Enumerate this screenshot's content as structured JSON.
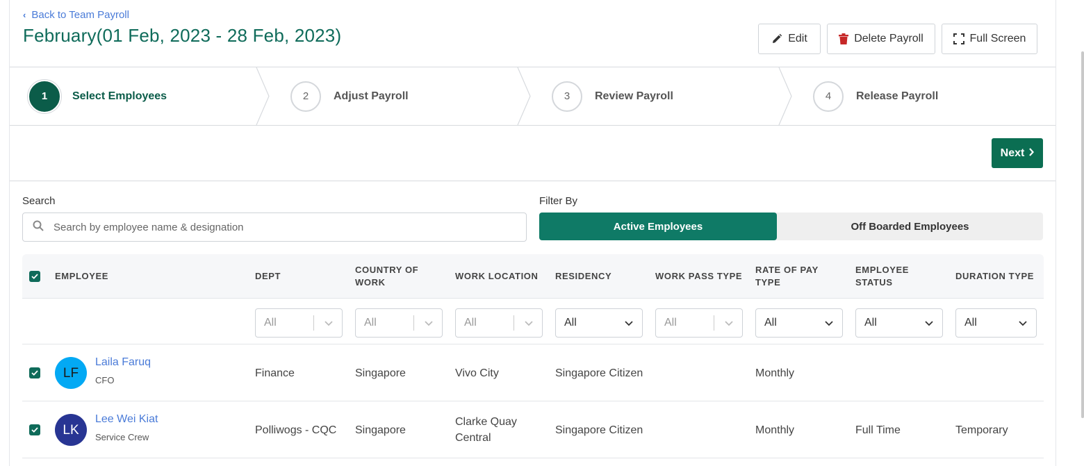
{
  "header": {
    "back_label": "Back to Team Payroll",
    "title": "February(01 Feb, 2023 - 28 Feb, 2023)",
    "edit_label": "Edit",
    "delete_label": "Delete Payroll",
    "fullscreen_label": "Full Screen"
  },
  "steps": [
    {
      "num": "1",
      "label": "Select Employees",
      "active": true
    },
    {
      "num": "2",
      "label": "Adjust Payroll",
      "active": false
    },
    {
      "num": "3",
      "label": "Review Payroll",
      "active": false
    },
    {
      "num": "4",
      "label": "Release Payroll",
      "active": false
    }
  ],
  "next_label": "Next",
  "search": {
    "label": "Search",
    "placeholder": "Search by employee name & designation",
    "value": ""
  },
  "filter": {
    "label": "Filter By",
    "options": [
      "Active Employees",
      "Off Boarded Employees"
    ],
    "selected": "Active Employees"
  },
  "table": {
    "columns": [
      "EMPLOYEE",
      "DEPT",
      "COUNTRY OF WORK",
      "WORK LOCATION",
      "RESIDENCY",
      "WORK PASS TYPE",
      "RATE OF PAY TYPE",
      "EMPLOYEE STATUS",
      "DURATION TYPE"
    ],
    "column_lines": [
      [
        "EMPLOYEE"
      ],
      [
        "DEPT"
      ],
      [
        "COUNTRY OF",
        "WORK"
      ],
      [
        "WORK LOCATION"
      ],
      [
        "RESIDENCY"
      ],
      [
        "WORK PASS TYPE"
      ],
      [
        "RATE OF PAY",
        "TYPE"
      ],
      [
        "EMPLOYEE",
        "STATUS"
      ],
      [
        "DURATION TYPE"
      ]
    ],
    "filters": [
      "All",
      "All",
      "All",
      "All",
      "All",
      "All",
      "All",
      "All"
    ],
    "rows": [
      {
        "initials": "LF",
        "avatar_color": "#03a9f4",
        "avatar_text_color": "#1a1a1a",
        "name": "Laila Faruq",
        "designation": "CFO",
        "dept": "Finance",
        "country": "Singapore",
        "location": "Vivo City",
        "residency": "Singapore Citizen",
        "work_pass": "",
        "rate": "Monthly",
        "status": "",
        "duration": ""
      },
      {
        "initials": "LK",
        "avatar_color": "#283593",
        "avatar_text_color": "#ffffff",
        "name": "Lee Wei Kiat",
        "designation": "Service Crew",
        "dept": "Polliwogs - CQC",
        "country": "Singapore",
        "location": "Clarke Quay Central",
        "residency": "Singapore Citizen",
        "work_pass": "",
        "rate": "Monthly",
        "status": "Full Time",
        "duration": "Temporary"
      }
    ]
  },
  "colors": {
    "primary": "#0f6b5a",
    "next_button": "#0b6e52",
    "active_filter": "#0f7a66",
    "link": "#4a7bd8",
    "delete_icon": "#c62828"
  },
  "icons": {
    "back": "chevron-left-icon",
    "edit": "pencil-icon",
    "delete": "trash-icon",
    "fullscreen": "expand-icon",
    "next": "chevron-right-icon",
    "search": "search-icon",
    "select": "chevron-down-icon",
    "checkbox": "check-icon"
  }
}
